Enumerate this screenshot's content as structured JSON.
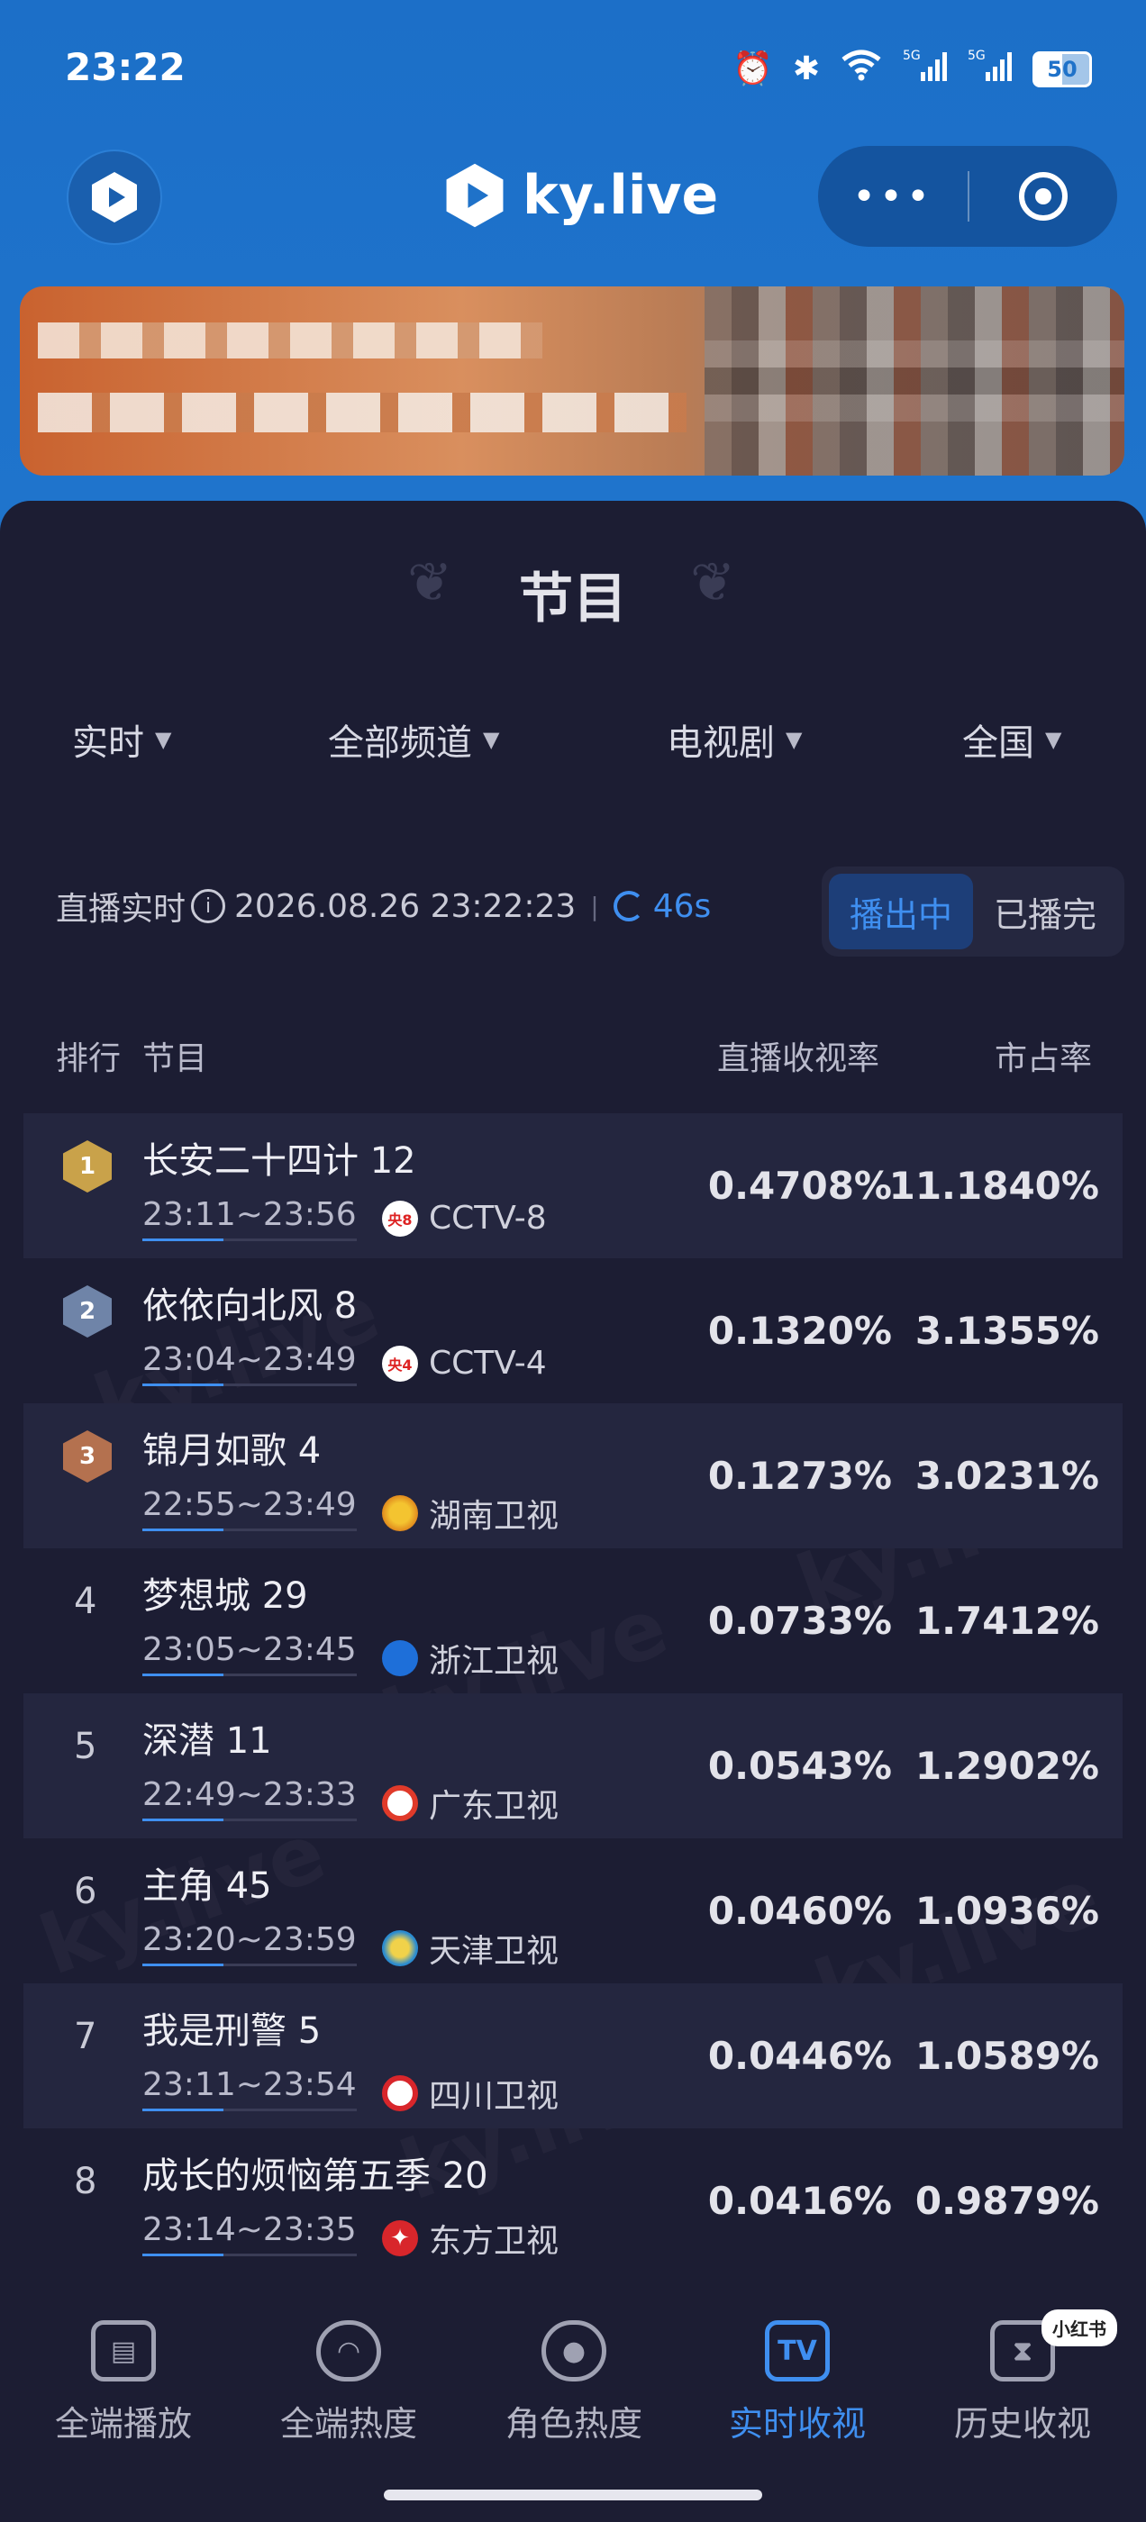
{
  "status_bar": {
    "time": "23:22",
    "battery": "50",
    "icons": [
      "alarm-icon",
      "bluetooth-icon",
      "wifi-icon",
      "signal-5g-icon",
      "signal-5g-icon"
    ]
  },
  "header": {
    "brand": "ky.live",
    "more_label": "•••"
  },
  "panel": {
    "title": "节目",
    "filters": [
      "实时",
      "全部频道",
      "电视剧",
      "全国"
    ],
    "live_label": "直播实时",
    "timestamp": "2026.08.26 23:22:23",
    "countdown": "46s",
    "toggle": {
      "on_air": "播出中",
      "finished": "已播完"
    }
  },
  "table": {
    "headers": {
      "rank": "排行",
      "program": "节目",
      "rating": "直播收视率",
      "share": "市占率"
    },
    "rows": [
      {
        "rank": "1",
        "title": "长安二十四计 12",
        "time": "23:11~23:56",
        "channel": "CCTV-8",
        "channel_badge": "央8",
        "rating": "0.4708%",
        "share": "11.1840%"
      },
      {
        "rank": "2",
        "title": "依依向北风 8",
        "time": "23:04~23:49",
        "channel": "CCTV-4",
        "channel_badge": "央4",
        "rating": "0.1320%",
        "share": "3.1355%"
      },
      {
        "rank": "3",
        "title": "锦月如歌 4",
        "time": "22:55~23:49",
        "channel": "湖南卫视",
        "channel_badge": "",
        "rating": "0.1273%",
        "share": "3.0231%"
      },
      {
        "rank": "4",
        "title": "梦想城 29",
        "time": "23:05~23:45",
        "channel": "浙江卫视",
        "channel_badge": "",
        "rating": "0.0733%",
        "share": "1.7412%"
      },
      {
        "rank": "5",
        "title": "深潜 11",
        "time": "22:49~23:33",
        "channel": "广东卫视",
        "channel_badge": "",
        "rating": "0.0543%",
        "share": "1.2902%"
      },
      {
        "rank": "6",
        "title": "主角 45",
        "time": "23:20~23:59",
        "channel": "天津卫视",
        "channel_badge": "",
        "rating": "0.0460%",
        "share": "1.0936%"
      },
      {
        "rank": "7",
        "title": "我是刑警 5",
        "time": "23:11~23:54",
        "channel": "四川卫视",
        "channel_badge": "",
        "rating": "0.0446%",
        "share": "1.0589%"
      },
      {
        "rank": "8",
        "title": "成长的烦恼第五季 20",
        "time": "23:14~23:35",
        "channel": "东方卫视",
        "channel_badge": "",
        "rating": "0.0416%",
        "share": "0.9879%"
      }
    ]
  },
  "watermark": "ky.live",
  "bottom_nav": [
    {
      "label": "全端播放",
      "icon": "book-icon"
    },
    {
      "label": "全端热度",
      "icon": "flame-icon"
    },
    {
      "label": "角色热度",
      "icon": "person-icon"
    },
    {
      "label": "实时收视",
      "icon": "tv-icon",
      "glyph": "TV"
    },
    {
      "label": "历史收视",
      "icon": "history-icon"
    }
  ],
  "source_tag": "小红书",
  "colors": {
    "accent": "#3f8ff0",
    "header_blue": "#1f72c9",
    "panel_bg": "#1c1d33",
    "gold": "#c9a24a",
    "silver": "#6f84a8",
    "bronze": "#b4714f"
  }
}
